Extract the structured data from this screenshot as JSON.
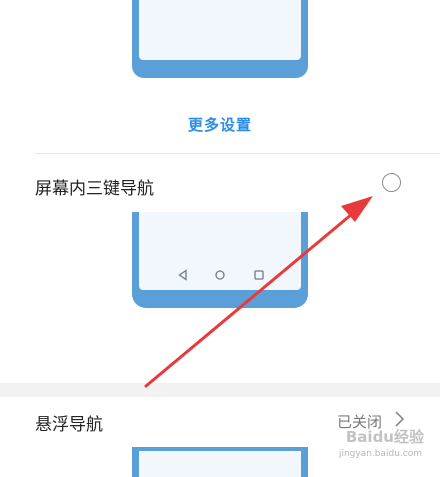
{
  "more_settings": {
    "label": "更多设置"
  },
  "three_key_nav": {
    "label": "屏幕内三键导航",
    "selected": false
  },
  "floating_nav": {
    "label": "悬浮导航",
    "status": "已关闭"
  },
  "watermark": {
    "brand": "Baidu经验",
    "url": "jingyan.baidu.com"
  },
  "colors": {
    "accent": "#2d8ce8",
    "illustration": "#5b9fd9",
    "annotation_arrow": "#e83a3a"
  }
}
